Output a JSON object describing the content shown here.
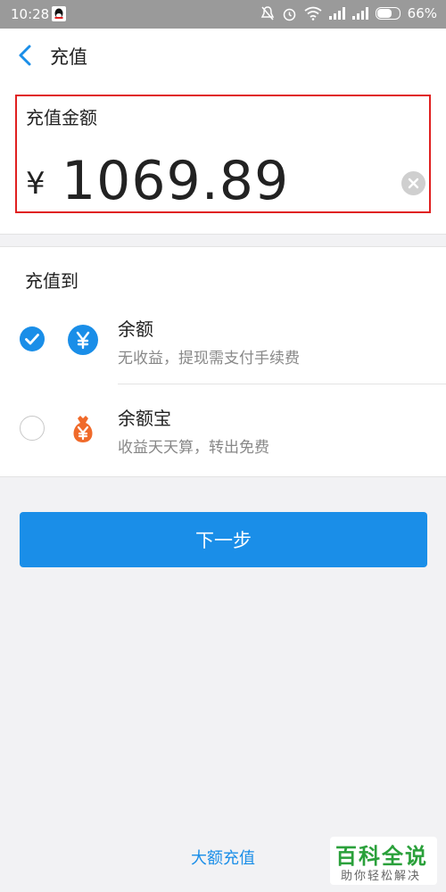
{
  "status_bar": {
    "time": "10:28",
    "battery": "66%",
    "battery_level": 0.66
  },
  "header": {
    "title": "充值"
  },
  "amount": {
    "label": "充值金额",
    "currency_symbol": "¥",
    "value": "1069.89"
  },
  "target": {
    "title": "充值到",
    "options": [
      {
        "name": "余额",
        "desc": "无收益，提现需支付手续费",
        "selected": true,
        "icon": "yen-circle-icon",
        "color": "#1a8ee8"
      },
      {
        "name": "余额宝",
        "desc": "收益天天算，转出免费",
        "selected": false,
        "icon": "money-bag-icon",
        "color": "#f06a2a"
      }
    ]
  },
  "actions": {
    "next_label": "下一步",
    "large_recharge_label": "大额充值"
  },
  "watermark": {
    "main": "百科全说",
    "sub": "助你轻松解决"
  },
  "colors": {
    "accent": "#1a8ee8",
    "highlight_border": "#e02020"
  }
}
